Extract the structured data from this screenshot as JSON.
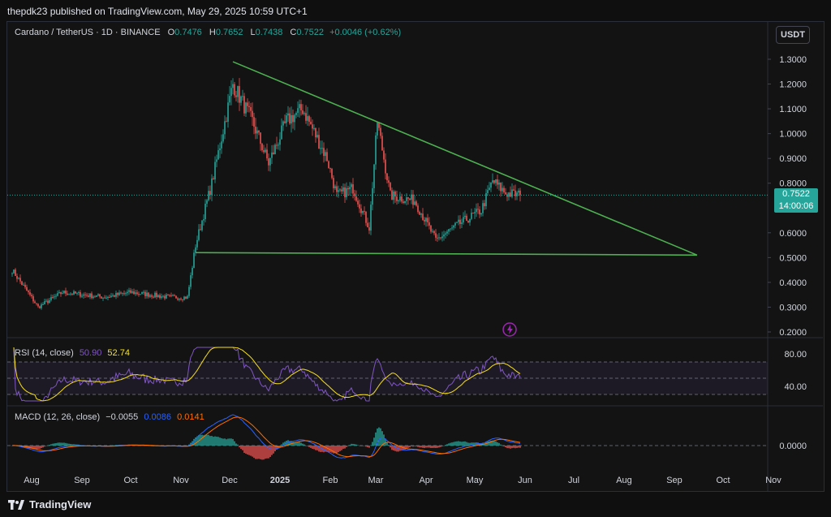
{
  "header": {
    "publisher": "thepdk23 published on TradingView.com, May 29, 2025 10:59 UTC+1"
  },
  "currency_button": "USDT",
  "legend": {
    "symbol": "Cardano / TetherUS · 1D · BINANCE",
    "o_label": "O",
    "o": "0.7476",
    "h_label": "H",
    "h": "0.7652",
    "l_label": "L",
    "l": "0.7438",
    "c_label": "C",
    "c": "0.7522",
    "change": "+0.0046 (+0.62%)"
  },
  "price_tag": {
    "price": "0.7522",
    "countdown": "14:00:06"
  },
  "rsi_title": {
    "label": "RSI (14, close)",
    "rsi": "50.90",
    "ma": "52.74"
  },
  "macd_title": {
    "label": "MACD (12, 26, close)",
    "hist": "−0.0055",
    "macd": "0.0086",
    "signal": "0.0141"
  },
  "footer": {
    "brand": "TradingView"
  },
  "colors": {
    "up": "#26a69a",
    "down": "#ef5350",
    "trend": "#4caf50",
    "rsi": "#7e57c2",
    "rsi_ma": "#f7e11b",
    "macd": "#2962ff",
    "signal": "#ff6d00"
  },
  "chart_data": [
    {
      "type": "candlestick",
      "title": "Cardano / TetherUS · 1D · BINANCE",
      "x_tick_labels": [
        "Aug",
        "Sep",
        "Oct",
        "Nov",
        "Dec",
        "2025",
        "Feb",
        "Mar",
        "Apr",
        "May",
        "Jun",
        "Jul",
        "Aug",
        "Sep",
        "Oct",
        "Nov"
      ],
      "y_tick_labels": [
        "1.3000",
        "1.2000",
        "1.1000",
        "1.0000",
        "0.9000",
        "0.8000",
        "0.6000",
        "0.5000",
        "0.4000",
        "0.3000",
        "0.2000"
      ],
      "ylim": [
        0.18,
        1.35
      ],
      "approx_close_path": [
        {
          "x": "Jul 20",
          "y": 0.45
        },
        {
          "x": "Aug 5",
          "y": 0.3
        },
        {
          "x": "Aug 20",
          "y": 0.36
        },
        {
          "x": "Sep 15",
          "y": 0.34
        },
        {
          "x": "Oct 1",
          "y": 0.36
        },
        {
          "x": "Oct 25",
          "y": 0.34
        },
        {
          "x": "Nov 5",
          "y": 0.34
        },
        {
          "x": "Nov 10",
          "y": 0.55
        },
        {
          "x": "Nov 20",
          "y": 0.8
        },
        {
          "x": "Dec 3",
          "y": 1.2
        },
        {
          "x": "Dec 15",
          "y": 1.05
        },
        {
          "x": "Dec 25",
          "y": 0.88
        },
        {
          "x": "Jan 5",
          "y": 1.05
        },
        {
          "x": "Jan 15",
          "y": 1.1
        },
        {
          "x": "Jan 30",
          "y": 0.9
        },
        {
          "x": "Feb 5",
          "y": 0.75
        },
        {
          "x": "Feb 15",
          "y": 0.78
        },
        {
          "x": "Feb 25",
          "y": 0.62
        },
        {
          "x": "Mar 2",
          "y": 1.05
        },
        {
          "x": "Mar 10",
          "y": 0.75
        },
        {
          "x": "Mar 25",
          "y": 0.73
        },
        {
          "x": "Apr 7",
          "y": 0.57
        },
        {
          "x": "Apr 20",
          "y": 0.63
        },
        {
          "x": "May 5",
          "y": 0.69
        },
        {
          "x": "May 12",
          "y": 0.81
        },
        {
          "x": "May 20",
          "y": 0.76
        },
        {
          "x": "May 29",
          "y": 0.7522
        }
      ],
      "lines": [
        {
          "kind": "descending trendline",
          "from": {
            "x": "Dec 3",
            "y": 1.29
          },
          "to": {
            "x": "Sep 15",
            "y": 0.51
          }
        },
        {
          "kind": "horizontal support",
          "from": {
            "x": "Nov 10",
            "y": 0.52
          },
          "to": {
            "x": "Sep 15",
            "y": 0.51
          }
        }
      ],
      "last_price": 0.7522
    },
    {
      "type": "line",
      "title": "RSI (14, close)",
      "y_tick_labels": [
        "80.00",
        "40.00"
      ],
      "bands": [
        70,
        30
      ],
      "series": [
        {
          "name": "RSI",
          "last": 50.9
        },
        {
          "name": "RSI MA",
          "last": 52.74
        }
      ]
    },
    {
      "type": "line",
      "title": "MACD (12, 26, close)",
      "y_tick_labels": [
        "0.0000"
      ],
      "series": [
        {
          "name": "Histogram",
          "last": -0.0055
        },
        {
          "name": "MACD",
          "last": 0.0086
        },
        {
          "name": "Signal",
          "last": 0.0141
        }
      ]
    }
  ]
}
